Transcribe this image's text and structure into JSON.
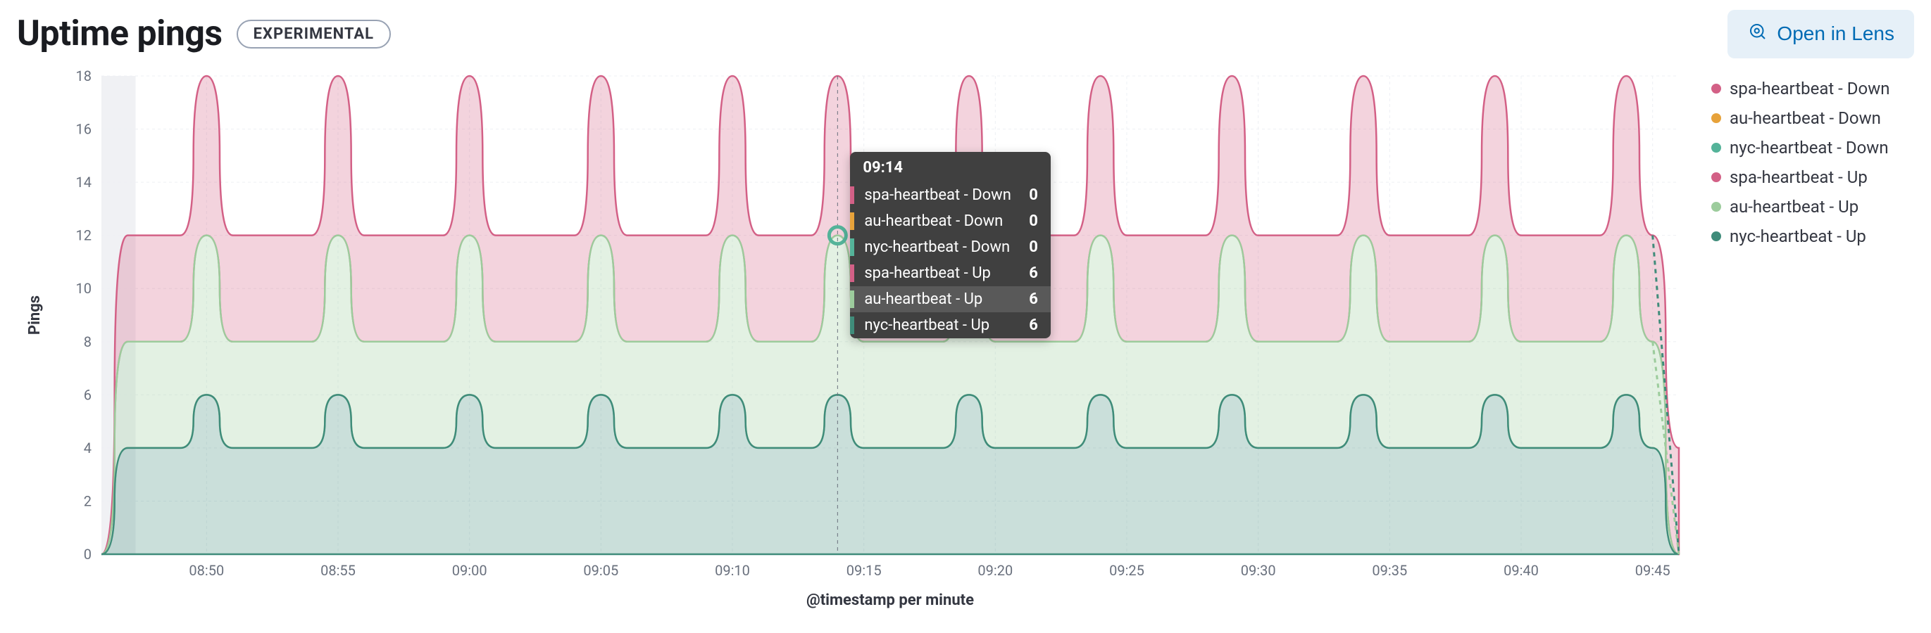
{
  "header": {
    "title": "Uptime pings",
    "badge": "EXPERIMENTAL",
    "open_in_lens": "Open in Lens"
  },
  "legend": [
    {
      "label": "spa-heartbeat - Down",
      "color": "#d36086"
    },
    {
      "label": "au-heartbeat - Down",
      "color": "#e7a23a"
    },
    {
      "label": "nyc-heartbeat - Down",
      "color": "#54b399"
    },
    {
      "label": "spa-heartbeat - Up",
      "color": "#d36086"
    },
    {
      "label": "au-heartbeat - Up",
      "color": "#9ccc9c"
    },
    {
      "label": "nyc-heartbeat - Up",
      "color": "#3f8c7a"
    }
  ],
  "tooltip": {
    "time": "09:14",
    "rows": [
      {
        "label": "spa-heartbeat - Down",
        "value": 0,
        "color": "#d36086",
        "hl": false
      },
      {
        "label": "au-heartbeat - Down",
        "value": 0,
        "color": "#e7a23a",
        "hl": false
      },
      {
        "label": "nyc-heartbeat - Down",
        "value": 0,
        "color": "#54b399",
        "hl": false
      },
      {
        "label": "spa-heartbeat - Up",
        "value": 6,
        "color": "#d36086",
        "hl": false
      },
      {
        "label": "au-heartbeat - Up",
        "value": 6,
        "color": "#9ccc9c",
        "hl": true
      },
      {
        "label": "nyc-heartbeat - Up",
        "value": 6,
        "color": "#3f8c7a",
        "hl": false
      }
    ]
  },
  "chart_data": {
    "type": "area",
    "stacked": true,
    "xlabel": "@timestamp per minute",
    "ylabel": "Pings",
    "ylim": [
      0,
      18
    ],
    "yticks": [
      0,
      2,
      4,
      6,
      8,
      10,
      12,
      14,
      16,
      18
    ],
    "xticks": [
      "08:50",
      "08:55",
      "09:00",
      "09:05",
      "09:10",
      "09:15",
      "09:20",
      "09:25",
      "09:30",
      "09:35",
      "09:40",
      "09:45"
    ],
    "x_minutes": [
      46,
      47,
      48,
      49,
      50,
      51,
      52,
      53,
      54,
      55,
      56,
      57,
      58,
      59,
      60,
      61,
      62,
      63,
      64,
      65,
      66,
      67,
      68,
      69,
      70,
      71,
      72,
      73,
      74,
      75,
      76,
      77,
      78,
      79,
      80,
      81,
      82,
      83,
      84,
      85,
      86,
      87,
      88,
      89,
      90,
      91,
      92,
      93,
      94,
      95,
      96,
      97,
      98,
      99,
      100,
      101,
      102,
      103,
      104,
      105,
      106
    ],
    "x_minute_labels": [
      "08:46",
      "08:47",
      "08:48",
      "08:49",
      "08:50",
      "08:51",
      "08:52",
      "08:53",
      "08:54",
      "08:55",
      "08:56",
      "08:57",
      "08:58",
      "08:59",
      "09:00",
      "09:01",
      "09:02",
      "09:03",
      "09:04",
      "09:05",
      "09:06",
      "09:07",
      "09:08",
      "09:09",
      "09:10",
      "09:11",
      "09:12",
      "09:13",
      "09:14",
      "09:15",
      "09:16",
      "09:17",
      "09:18",
      "09:19",
      "09:20",
      "09:21",
      "09:22",
      "09:23",
      "09:24",
      "09:25",
      "09:26",
      "09:27",
      "09:28",
      "09:29",
      "09:30",
      "09:31",
      "09:32",
      "09:33",
      "09:34",
      "09:35",
      "09:36",
      "09:37",
      "09:38",
      "09:39",
      "09:40",
      "09:41",
      "09:42",
      "09:43",
      "09:44",
      "09:45",
      "09:46"
    ],
    "series": [
      {
        "name": "nyc-heartbeat - Up",
        "color": "#3f8c7a",
        "values_stack_top": [
          0,
          4,
          4,
          4,
          6,
          4,
          4,
          4,
          4,
          6,
          4,
          4,
          4,
          4,
          6,
          4,
          4,
          4,
          4,
          6,
          4,
          4,
          4,
          4,
          6,
          4,
          4,
          4,
          6,
          4,
          4,
          4,
          4,
          6,
          4,
          4,
          4,
          4,
          6,
          4,
          4,
          4,
          4,
          6,
          4,
          4,
          4,
          4,
          6,
          4,
          4,
          4,
          4,
          6,
          4,
          4,
          4,
          4,
          6,
          4,
          0
        ]
      },
      {
        "name": "au-heartbeat - Up",
        "color": "#9ccc9c",
        "values_stack_top": [
          0,
          8,
          8,
          8,
          12,
          8,
          8,
          8,
          8,
          12,
          8,
          8,
          8,
          8,
          12,
          8,
          8,
          8,
          8,
          12,
          8,
          8,
          8,
          8,
          12,
          8,
          8,
          8,
          12,
          8,
          8,
          8,
          8,
          12,
          8,
          8,
          8,
          8,
          12,
          8,
          8,
          8,
          8,
          12,
          8,
          8,
          8,
          8,
          12,
          8,
          8,
          8,
          8,
          12,
          8,
          8,
          8,
          8,
          12,
          8,
          0
        ]
      },
      {
        "name": "spa-heartbeat - Up",
        "color": "#d36086",
        "values_stack_top": [
          0,
          12,
          12,
          12,
          18,
          12,
          12,
          12,
          12,
          18,
          12,
          12,
          12,
          12,
          18,
          12,
          12,
          12,
          12,
          18,
          12,
          12,
          12,
          12,
          18,
          12,
          12,
          12,
          18,
          12,
          12,
          12,
          12,
          18,
          12,
          12,
          12,
          12,
          18,
          12,
          12,
          12,
          12,
          18,
          12,
          12,
          12,
          12,
          18,
          12,
          12,
          12,
          12,
          18,
          12,
          12,
          12,
          12,
          18,
          12,
          4
        ]
      },
      {
        "name": "nyc-heartbeat - Down",
        "color": "#54b399",
        "values_stack_top": [
          0,
          12,
          12,
          12,
          18,
          12,
          12,
          12,
          12,
          18,
          12,
          12,
          12,
          12,
          18,
          12,
          12,
          12,
          12,
          18,
          12,
          12,
          12,
          12,
          18,
          12,
          12,
          12,
          18,
          12,
          12,
          12,
          12,
          18,
          12,
          12,
          12,
          12,
          18,
          12,
          12,
          12,
          12,
          18,
          12,
          12,
          12,
          12,
          18,
          12,
          12,
          12,
          12,
          18,
          12,
          12,
          12,
          12,
          18,
          12,
          4
        ]
      },
      {
        "name": "au-heartbeat - Down",
        "color": "#e7a23a",
        "values_stack_top": [
          0,
          12,
          12,
          12,
          18,
          12,
          12,
          12,
          12,
          18,
          12,
          12,
          12,
          12,
          18,
          12,
          12,
          12,
          12,
          18,
          12,
          12,
          12,
          12,
          18,
          12,
          12,
          12,
          18,
          12,
          12,
          12,
          12,
          18,
          12,
          12,
          12,
          12,
          18,
          12,
          12,
          12,
          12,
          18,
          12,
          12,
          12,
          12,
          18,
          12,
          12,
          12,
          12,
          18,
          12,
          12,
          12,
          12,
          18,
          12,
          4
        ]
      },
      {
        "name": "spa-heartbeat - Down",
        "color": "#d36086",
        "values_stack_top": [
          0,
          12,
          12,
          12,
          18,
          12,
          12,
          12,
          12,
          18,
          12,
          12,
          12,
          12,
          18,
          12,
          12,
          12,
          12,
          18,
          12,
          12,
          12,
          12,
          18,
          12,
          12,
          12,
          18,
          12,
          12,
          12,
          12,
          18,
          12,
          12,
          12,
          12,
          18,
          12,
          12,
          12,
          12,
          18,
          12,
          12,
          12,
          12,
          18,
          12,
          12,
          12,
          12,
          18,
          12,
          12,
          12,
          12,
          18,
          12,
          4
        ]
      }
    ],
    "hover_x_minute": 74,
    "edge_trail": {
      "from_minute": 105,
      "from_top": 12,
      "to_minute": 106,
      "to_top": 0,
      "style": "dashed"
    },
    "shaded_left_band_minutes": [
      46,
      47.3
    ]
  }
}
